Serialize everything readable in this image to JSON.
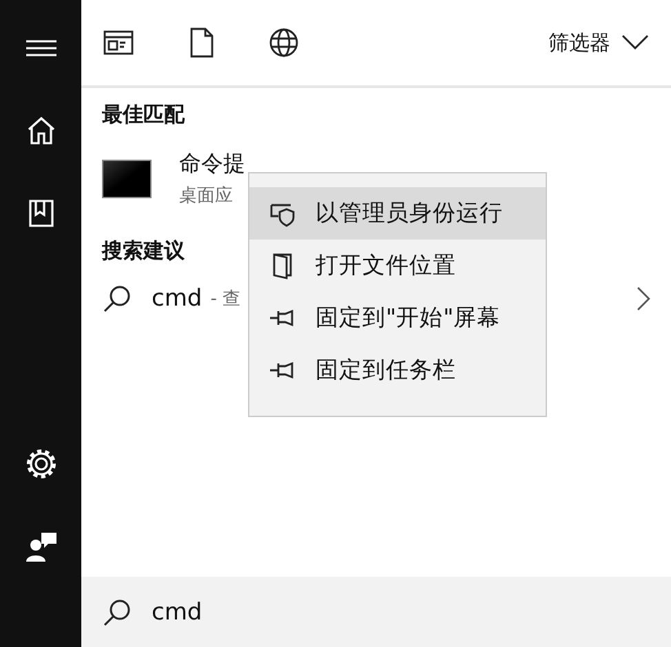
{
  "sidebar": {
    "top_items": [
      {
        "kind": "menu"
      },
      {
        "kind": "home"
      },
      {
        "kind": "book"
      }
    ],
    "bottom_items": [
      {
        "kind": "settings"
      },
      {
        "kind": "feedback"
      }
    ]
  },
  "toolbar": {
    "scopes": [
      {
        "kind": "apps"
      },
      {
        "kind": "documents"
      },
      {
        "kind": "web"
      }
    ],
    "filter": "筛选器"
  },
  "best_match": {
    "heading": "最佳匹配",
    "title": "命令提",
    "subtitle": "桌面应"
  },
  "suggestions": {
    "heading": "搜索建议",
    "items": [
      {
        "query": "cmd",
        "hint": "- 查"
      }
    ]
  },
  "context_menu": [
    {
      "kind": "shield",
      "label": "以管理员身份运行",
      "selected": true
    },
    {
      "kind": "folder",
      "label": "打开文件位置",
      "selected": false
    },
    {
      "kind": "pin",
      "label": "固定到\"开始\"屏幕",
      "selected": false
    },
    {
      "kind": "pin",
      "label": "固定到任务栏",
      "selected": false
    }
  ],
  "search_box": {
    "value": "cmd"
  }
}
